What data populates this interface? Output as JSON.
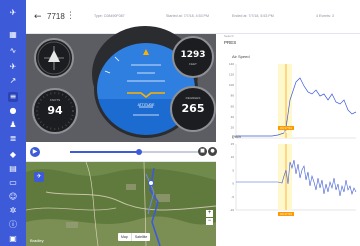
{
  "header": {
    "back_glyph": "←",
    "flight_id": "7718",
    "more_glyph": "⋮",
    "fields": [
      "Type: C08490F087",
      "Started at: 7/7/18, 4:53 PM",
      "Ended at: 7/7/18, 5:53 PM",
      "4 Events: 3"
    ]
  },
  "sidebar": {
    "icons": [
      "logo-icon",
      "dashboard-icon",
      "chart-icon",
      "plane-icon",
      "route-icon",
      "timeline-icon",
      "location-icon",
      "person-icon",
      "stack-icon",
      "tag-icon",
      "document-icon",
      "flight-icon",
      "user-icon",
      "settings-icon",
      "info-icon",
      "grid-icon"
    ]
  },
  "gauges": {
    "airspeed": {
      "value": "94",
      "unit": "KNOTS"
    },
    "altitude": {
      "value": "1293",
      "unit": "FEET"
    },
    "heading": {
      "value": "265",
      "unit": "DEGREES"
    },
    "attitude_label": "ATTITUDE"
  },
  "player": {
    "play_glyph": "▶",
    "progress": 0.54,
    "stop_glyph": "■",
    "snapshot_glyph": "●"
  },
  "map": {
    "zoom_in": "+",
    "zoom_out": "−",
    "map_label": "Map",
    "satellite_label": "Satellite",
    "footer": "Bradley"
  },
  "charts_panel": {
    "header_small": "Search",
    "header": "PRES",
    "charts": [
      {
        "title": "Air Speed",
        "y_ticks": [
          "140",
          "120",
          "100",
          "80",
          "60",
          "40",
          "20",
          "0"
        ],
        "cursor_label": "04:17:54 PM"
      },
      {
        "title": "Pitch",
        "y_ticks": [
          "15",
          "10",
          "5",
          "0",
          "-5",
          "-10"
        ],
        "cursor_label": "04:17:54 PM"
      }
    ]
  },
  "colors": {
    "accent": "#3d5bd9",
    "cursor": "#ff9900",
    "series": "#3d5bd9"
  }
}
